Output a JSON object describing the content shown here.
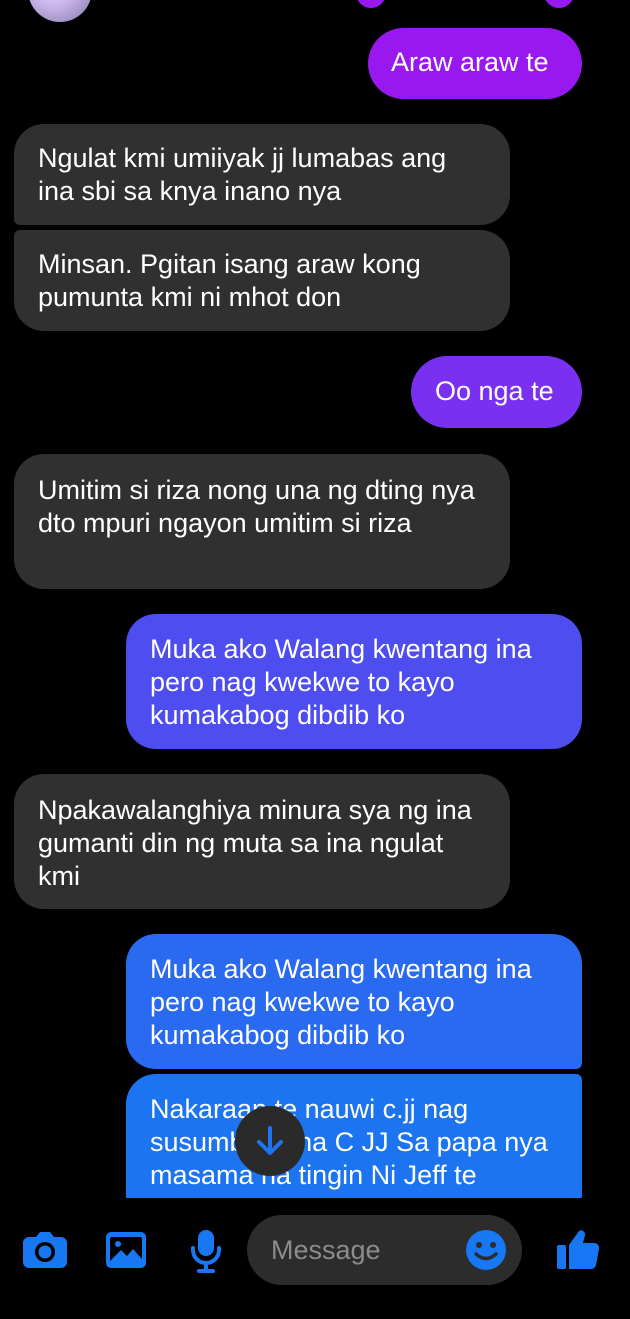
{
  "messages": [
    {
      "id": "m1",
      "dir": "out",
      "text": "Araw araw te"
    },
    {
      "id": "m2",
      "dir": "in",
      "text": "Ngulat kmi umiiyak jj lumabas ang ina sbi sa knya inano nya"
    },
    {
      "id": "m3",
      "dir": "in",
      "text": "Minsan. Pgitan isang araw kong pumunta kmi ni mhot don"
    },
    {
      "id": "m4",
      "dir": "out",
      "text": "Oo nga te"
    },
    {
      "id": "m5",
      "dir": "in",
      "text": "Umitim si riza nong una ng dting nya dto mpuri ngayon umitim si riza"
    },
    {
      "id": "m6",
      "dir": "out",
      "text": "Muka ako Walang kwentang ina pero nag kwekwe to kayo kumakabog dibdib ko"
    },
    {
      "id": "m7",
      "dir": "in",
      "text": "Npakawalanghiya minura sya ng ina gumanti din ng muta sa ina ngulat kmi"
    },
    {
      "id": "m8",
      "dir": "out",
      "text": "Muka ako Walang kwentang ina pero nag kwekwe to kayo kumakabog dibdib ko"
    },
    {
      "id": "m9",
      "dir": "out",
      "text": "Nakaraan te nauwi c.jj nag susumbong na C JJ Sa papa nya masama na tingin Ni Jeff te"
    }
  ],
  "composer": {
    "placeholder": "Message"
  },
  "icons": {
    "camera": "camera-icon",
    "gallery": "gallery-icon",
    "microphone": "microphone-icon",
    "emoji": "emoji-icon",
    "like": "like-icon",
    "jump": "arrow-down-icon"
  },
  "colors": {
    "background": "#000000",
    "incoming_bubble": "#303030",
    "outgoing_purple": "#9a18f0",
    "outgoing_violet": "#7a30f0",
    "outgoing_indigo": "#4e4ef0",
    "outgoing_blue": "#2a6af0",
    "accent_blue": "#1877f2"
  }
}
